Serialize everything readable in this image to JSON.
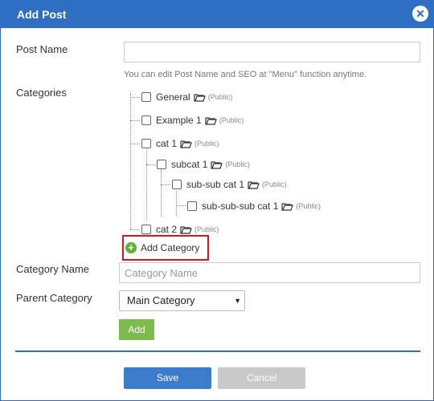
{
  "dialog": {
    "title": "Add Post",
    "close_icon": "close-icon"
  },
  "form": {
    "post_name_label": "Post Name",
    "post_name_value": "",
    "post_name_hint": "You can edit Post Name and SEO at \"Menu\" function anytime.",
    "categories_label": "Categories",
    "category_name_label": "Category Name",
    "category_name_placeholder": "Category Name",
    "parent_category_label": "Parent Category",
    "parent_category_selected": "Main Category",
    "add_button": "Add",
    "add_category_link": "Add Category"
  },
  "tree": {
    "public_tag": "(Public)",
    "items": [
      {
        "label": "General",
        "checked": false,
        "depth": 0
      },
      {
        "label": "Example 1",
        "checked": false,
        "depth": 0
      },
      {
        "label": "cat 1",
        "checked": false,
        "depth": 0
      },
      {
        "label": "subcat 1",
        "checked": false,
        "depth": 1
      },
      {
        "label": "sub-sub cat 1",
        "checked": false,
        "depth": 2
      },
      {
        "label": "sub-sub-sub cat 1",
        "checked": false,
        "depth": 3
      },
      {
        "label": "cat 2",
        "checked": false,
        "depth": 0
      }
    ]
  },
  "footer": {
    "save_button": "Save",
    "cancel_button": "Cancel"
  },
  "colors": {
    "header_blue": "#2f6fc1",
    "add_green": "#7cbb4e",
    "highlight_red": "#d9161b",
    "cancel_gray": "#c9c9c9"
  }
}
